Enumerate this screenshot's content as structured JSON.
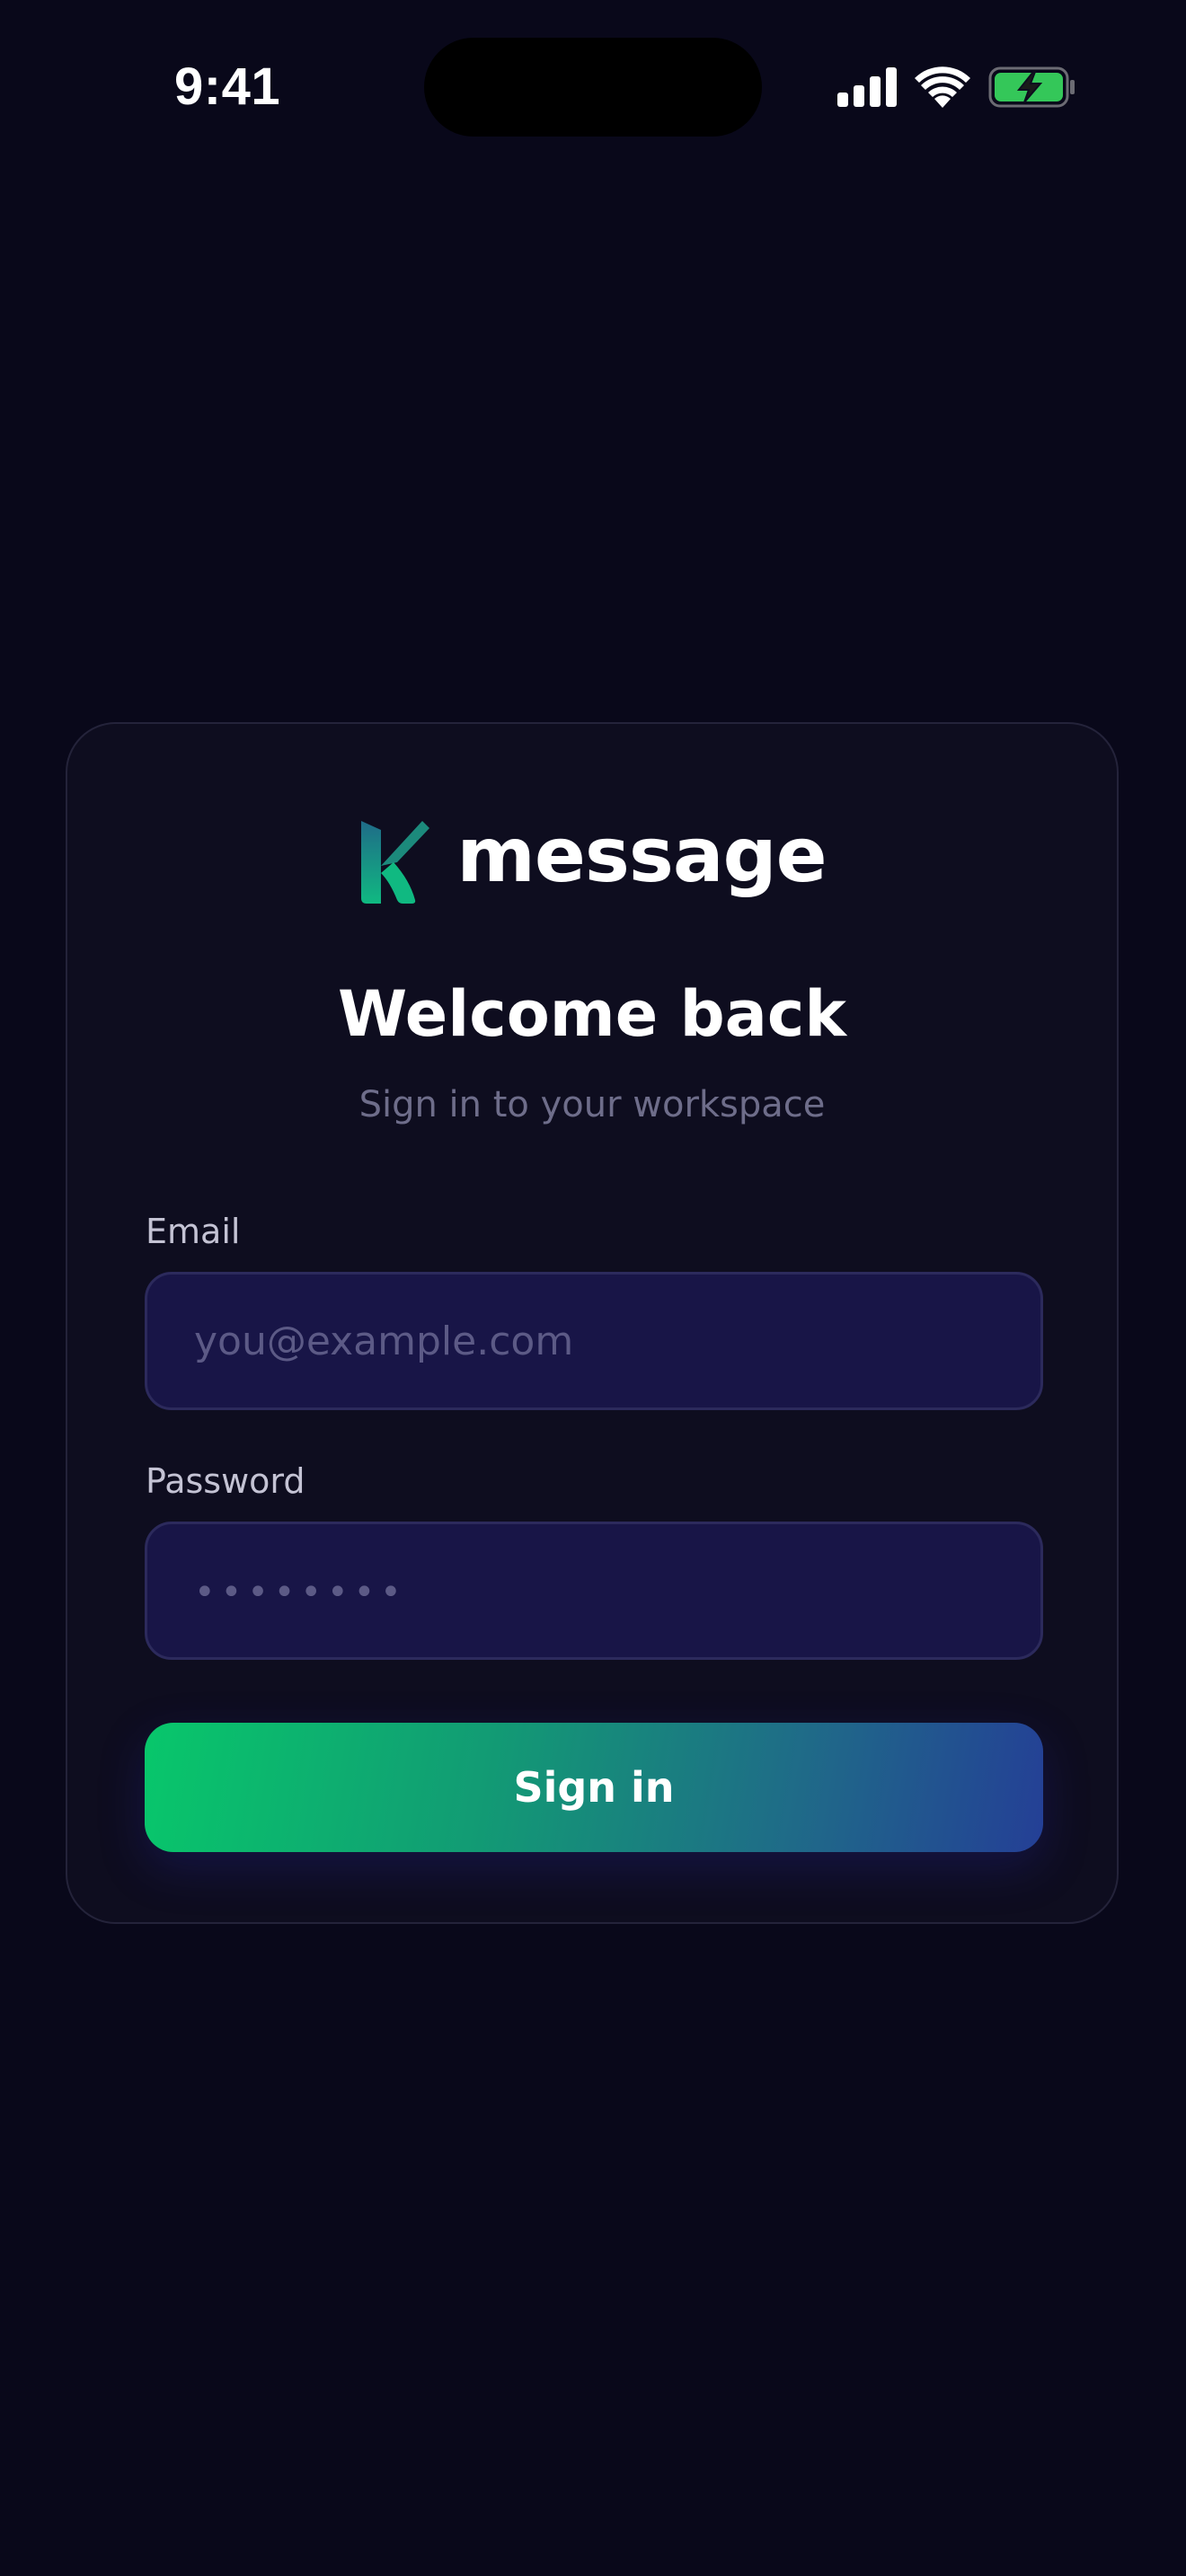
{
  "status_bar": {
    "time": "9:41",
    "icons": [
      "cellular-signal-icon",
      "wifi-icon",
      "battery-charging-icon"
    ],
    "battery_color": "#34c759"
  },
  "brand": {
    "name": "message",
    "logo": "k-logo-icon",
    "logo_colors": [
      "#1f6b88",
      "#10b981"
    ]
  },
  "login": {
    "title": "Welcome back",
    "subtitle": "Sign in to your workspace",
    "email_label": "Email",
    "email_placeholder": "you@example.com",
    "password_label": "Password",
    "password_placeholder": "••••••••",
    "submit_label": "Sign in"
  },
  "colors": {
    "background": "#09081a",
    "card": "#0e0d1f",
    "input_background": "#181547",
    "button_gradient": [
      "#08c76b",
      "#243f96"
    ]
  }
}
